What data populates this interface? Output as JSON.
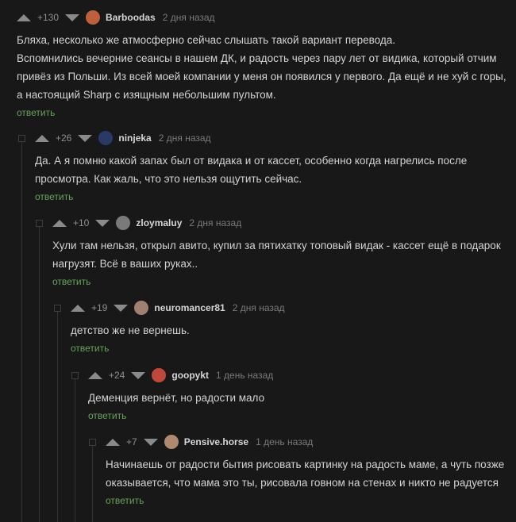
{
  "comments": [
    {
      "rating": "+130",
      "user": "Barboodas",
      "time": "2 дня назад",
      "avatar_color": "#c0603a",
      "reply": "ответить",
      "text": "Бляха, несколько же атмосферно сейчас слышать такой вариант перевода.\nВспомнились вечерние сеансы в нашем ДК, и радость через пару лет от видика, который отчим\nпривёз из Польши. Из всей моей компании у меня он появился у первого. Да ещё и не хуй с горы,\nа настоящий Sharp с изящным небольшим пультом."
    },
    {
      "rating": "+26",
      "user": "ninjeka",
      "time": "2 дня назад",
      "avatar_color": "#2a3a66",
      "reply": "ответить",
      "text": "Да. А я помню какой запах был от видака и от кассет, особенно когда нагрелись после\nпросмотра. Как жаль, что это нельзя ощутить сейчас."
    },
    {
      "rating": "+10",
      "user": "zloymaluy",
      "time": "2 дня назад",
      "avatar_color": "#7a7a7a",
      "reply": "ответить",
      "text": "Хули там нельзя, открыл авито, купил за пятихатку топовый видак - кассет ещё в подарок\nнагрузят. Всё в ваших руках.."
    },
    {
      "rating": "+19",
      "user": "neuromancer81",
      "time": "2 дня назад",
      "avatar_color": "#a08070",
      "reply": "ответить",
      "text": "детство же не вернешь."
    },
    {
      "rating": "+24",
      "user": "goopykt",
      "time": "1 день назад",
      "avatar_color": "#c0483a",
      "reply": "ответить",
      "text": "Деменция вернёт, но радости мало"
    },
    {
      "rating": "+7",
      "user": "Pensive.horse",
      "time": "1 день назад",
      "avatar_color": "#b08a70",
      "reply": "ответить",
      "text": "Начинаешь от радости бытия рисовать картинку на радость маме, а чуть позже\nоказывается, что мама это ты, рисовала говном на стенах и никто не радуется"
    }
  ]
}
